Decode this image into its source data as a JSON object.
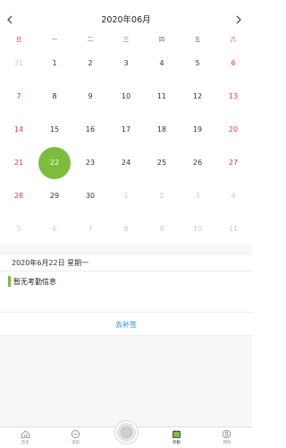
{
  "calendar": {
    "title": "2020年06月",
    "prev_icon": "chevron-left-icon",
    "next_icon": "chevron-right-icon",
    "weekdays": [
      "日",
      "一",
      "二",
      "三",
      "四",
      "五",
      "六"
    ],
    "days": [
      {
        "n": "31",
        "muted": true
      },
      {
        "n": "1"
      },
      {
        "n": "2"
      },
      {
        "n": "3"
      },
      {
        "n": "4"
      },
      {
        "n": "5"
      },
      {
        "n": "6"
      },
      {
        "n": "7"
      },
      {
        "n": "8"
      },
      {
        "n": "9"
      },
      {
        "n": "10"
      },
      {
        "n": "11"
      },
      {
        "n": "12"
      },
      {
        "n": "13"
      },
      {
        "n": "14"
      },
      {
        "n": "15"
      },
      {
        "n": "16"
      },
      {
        "n": "17"
      },
      {
        "n": "18"
      },
      {
        "n": "19"
      },
      {
        "n": "20"
      },
      {
        "n": "21"
      },
      {
        "n": "22",
        "selected": true
      },
      {
        "n": "23"
      },
      {
        "n": "24"
      },
      {
        "n": "25"
      },
      {
        "n": "26"
      },
      {
        "n": "27"
      },
      {
        "n": "28"
      },
      {
        "n": "29"
      },
      {
        "n": "30"
      },
      {
        "n": "1",
        "muted": true
      },
      {
        "n": "2",
        "muted": true
      },
      {
        "n": "3",
        "muted": true
      },
      {
        "n": "4",
        "muted": true
      },
      {
        "n": "5",
        "muted": true
      },
      {
        "n": "6",
        "muted": true
      },
      {
        "n": "7",
        "muted": true
      },
      {
        "n": "8",
        "muted": true
      },
      {
        "n": "9",
        "muted": true
      },
      {
        "n": "10",
        "muted": true
      },
      {
        "n": "11",
        "muted": true
      }
    ],
    "colors": {
      "weekend": "#e0373d",
      "selected": "#7dbd3e",
      "muted": "#c9c9c9"
    }
  },
  "selected_date_text": "2020年6月22日 星期一",
  "attendance": {
    "empty_text": "暂无考勤信息",
    "accent": "#7dbd3e"
  },
  "reissue_label": "去补签",
  "tabbar": {
    "tabs": [
      {
        "label": "首页",
        "icon": "home-icon"
      },
      {
        "label": "消息",
        "icon": "message-icon"
      },
      {
        "label": "",
        "icon": "center-action-icon"
      },
      {
        "label": "考勤",
        "icon": "calendar-icon",
        "active": true
      },
      {
        "label": "我的",
        "icon": "user-icon"
      }
    ]
  }
}
